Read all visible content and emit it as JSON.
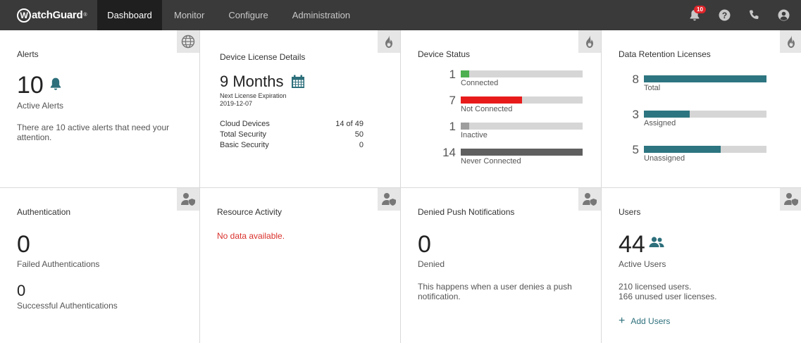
{
  "app": {
    "brand": "WatchGuard",
    "nav": [
      "Dashboard",
      "Monitor",
      "Configure",
      "Administration"
    ],
    "notification_count": "10",
    "icons": [
      "bell-icon",
      "help-icon",
      "phone-icon",
      "user-account-icon"
    ]
  },
  "cards": {
    "alerts": {
      "title": "Alerts",
      "count": "10",
      "count_label": "Active Alerts",
      "description": "There are 10 active alerts that need your attention."
    },
    "license": {
      "title": "Device License Details",
      "period": "9 Months",
      "expiration_label": "Next License Expiration",
      "expiration_date": "2019-12-07",
      "rows": [
        {
          "label": "Cloud Devices",
          "value": "14 of 49"
        },
        {
          "label": "Total Security",
          "value": "50"
        },
        {
          "label": "Basic Security",
          "value": "0"
        }
      ]
    },
    "device_status": {
      "title": "Device Status",
      "max": 14,
      "items": [
        {
          "count": "1",
          "value": 1,
          "label": "Connected",
          "color": "#4caf50"
        },
        {
          "count": "7",
          "value": 7,
          "label": "Not Connected",
          "color": "#e81b1b"
        },
        {
          "count": "1",
          "value": 1,
          "label": "Inactive",
          "color": "#9e9e9e"
        },
        {
          "count": "14",
          "value": 14,
          "label": "Never Connected",
          "color": "#5f5f5f"
        }
      ]
    },
    "data_retention": {
      "title": "Data Retention Licenses",
      "max": 8,
      "accent": "#2d7580",
      "items": [
        {
          "count": "8",
          "value": 8,
          "label": "Total"
        },
        {
          "count": "3",
          "value": 3,
          "label": "Assigned"
        },
        {
          "count": "5",
          "value": 5,
          "label": "Unassigned"
        }
      ]
    },
    "authentication": {
      "title": "Authentication",
      "failed_count": "0",
      "failed_label": "Failed Authentications",
      "success_count": "0",
      "success_label": "Successful Authentications"
    },
    "resource": {
      "title": "Resource Activity",
      "empty_text": "No data available."
    },
    "denied_push": {
      "title": "Denied Push Notifications",
      "count": "0",
      "count_label": "Denied",
      "description": "This happens when a user denies a push notification."
    },
    "users": {
      "title": "Users",
      "count": "44",
      "count_label": "Active Users",
      "licensed": "210 licensed users.",
      "unused": "166 unused user licenses.",
      "add_label": "Add Users"
    }
  }
}
